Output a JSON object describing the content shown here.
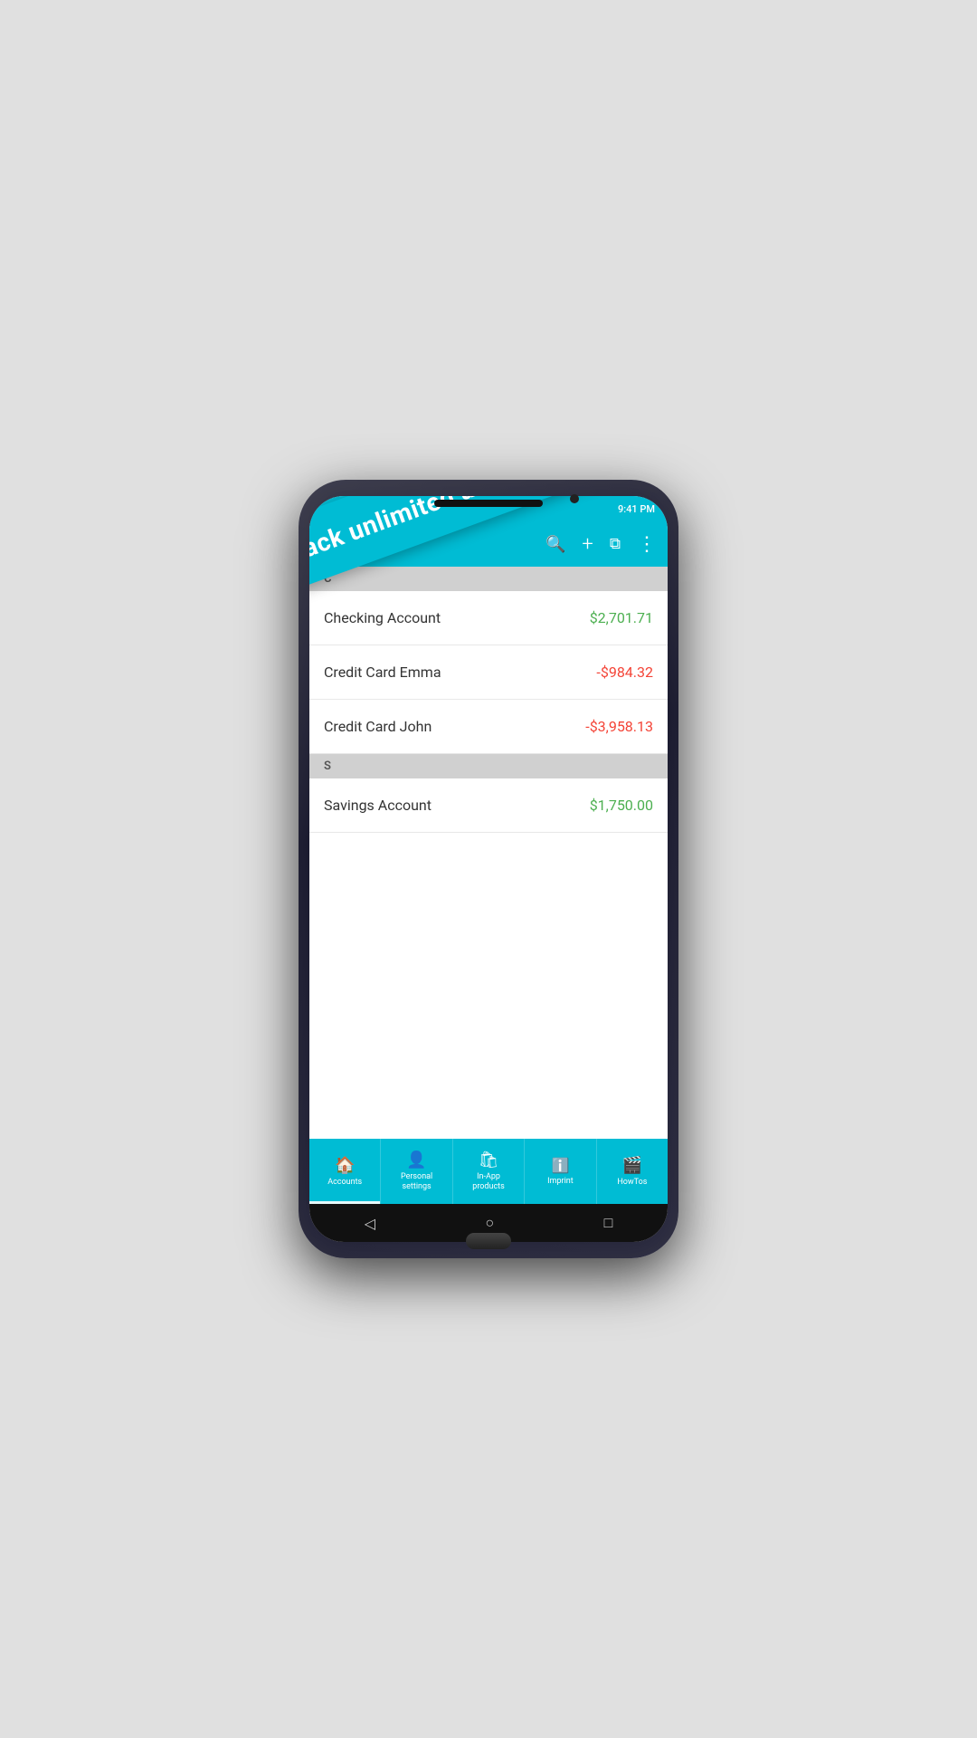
{
  "status": {
    "time": "9:41 PM"
  },
  "toolbar": {
    "search_icon": "🔍",
    "add_icon": "+",
    "export_icon": "⬚",
    "menu_icon": "⋮"
  },
  "banner": {
    "text": "Track unlimited accounts"
  },
  "sections": [
    {
      "letter": "C",
      "accounts": [
        {
          "name": "Checking Account",
          "balance": "$2,701.71",
          "positive": true
        },
        {
          "name": "Credit Card Emma",
          "balance": "-$984.32",
          "positive": false
        },
        {
          "name": "Credit Card John",
          "balance": "-$3,958.13",
          "positive": false
        }
      ]
    },
    {
      "letter": "S",
      "accounts": [
        {
          "name": "Savings Account",
          "balance": "$1,750.00",
          "positive": true
        }
      ]
    }
  ],
  "bottom_nav": [
    {
      "id": "accounts",
      "icon": "🏠",
      "label": "Accounts",
      "active": true
    },
    {
      "id": "personal",
      "icon": "👤",
      "label": "Personal\nsettings",
      "active": false
    },
    {
      "id": "inapp",
      "icon": "🛒",
      "label": "In-App\nproducts",
      "active": false
    },
    {
      "id": "imprint",
      "icon": "ℹ",
      "label": "Imprint",
      "active": false
    },
    {
      "id": "howtos",
      "icon": "🎬",
      "label": "HowTos",
      "active": false
    }
  ],
  "android_nav": {
    "back": "◁",
    "home": "○",
    "recent": "□"
  }
}
